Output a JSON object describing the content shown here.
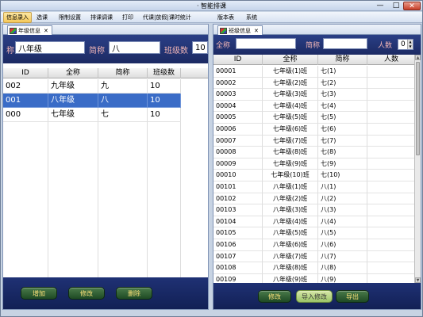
{
  "app": {
    "title": "· 智能排课",
    "minimize": "—",
    "maximize": "□",
    "close": "✕"
  },
  "menu": [
    "信息录入",
    "选课",
    "限制设置",
    "排课调课",
    "打印",
    "代课|放假|课时统计",
    "版本表",
    "系统"
  ],
  "left": {
    "tab_label": "年级信息",
    "tab_close": "✕",
    "form": {
      "name_label": "称",
      "name_value": "八年级",
      "short_label": "简称",
      "short_value": "八",
      "count_label": "班级数",
      "count_value": "10"
    },
    "columns": [
      "ID",
      "全称",
      "简称",
      "班级数"
    ],
    "rows": [
      {
        "id": "002",
        "name": "九年级",
        "short": "九",
        "count": "10",
        "selected": false
      },
      {
        "id": "001",
        "name": "八年级",
        "short": "八",
        "count": "10",
        "selected": true
      },
      {
        "id": "000",
        "name": "七年级",
        "short": "七",
        "count": "10",
        "selected": false
      }
    ],
    "buttons": [
      "增加",
      "修改",
      "删除"
    ]
  },
  "right": {
    "tab_label": "班级信息",
    "tab_close": "✕",
    "form": {
      "name_label": "全称",
      "name_value": "",
      "short_label": "简称",
      "short_value": "",
      "count_label": "人数",
      "count_value": "0"
    },
    "columns": [
      "ID",
      "全称",
      "简称",
      "人数"
    ],
    "rows": [
      {
        "id": "00001",
        "name": "七年级(1)班",
        "short": "七(1)"
      },
      {
        "id": "00002",
        "name": "七年级(2)班",
        "short": "七(2)"
      },
      {
        "id": "00003",
        "name": "七年级(3)班",
        "short": "七(3)"
      },
      {
        "id": "00004",
        "name": "七年级(4)班",
        "short": "七(4)"
      },
      {
        "id": "00005",
        "name": "七年级(5)班",
        "short": "七(5)"
      },
      {
        "id": "00006",
        "name": "七年级(6)班",
        "short": "七(6)"
      },
      {
        "id": "00007",
        "name": "七年级(7)班",
        "short": "七(7)"
      },
      {
        "id": "00008",
        "name": "七年级(8)班",
        "short": "七(8)"
      },
      {
        "id": "00009",
        "name": "七年级(9)班",
        "short": "七(9)"
      },
      {
        "id": "00010",
        "name": "七年级(10)班",
        "short": "七(10)"
      },
      {
        "id": "00101",
        "name": "八年级(1)班",
        "short": "八(1)"
      },
      {
        "id": "00102",
        "name": "八年级(2)班",
        "short": "八(2)"
      },
      {
        "id": "00103",
        "name": "八年级(3)班",
        "short": "八(3)"
      },
      {
        "id": "00104",
        "name": "八年级(4)班",
        "short": "八(4)"
      },
      {
        "id": "00105",
        "name": "八年级(5)班",
        "short": "八(5)"
      },
      {
        "id": "00106",
        "name": "八年级(6)班",
        "short": "八(6)"
      },
      {
        "id": "00107",
        "name": "八年级(7)班",
        "short": "八(7)"
      },
      {
        "id": "00108",
        "name": "八年级(8)班",
        "short": "八(8)"
      },
      {
        "id": "00109",
        "name": "八年级(9)班",
        "short": "八(9)"
      }
    ],
    "buttons": [
      "修改",
      "导入修改",
      "导出"
    ]
  },
  "colors": {
    "header_bg": "#1c2a63",
    "selected_row": "#3a6cc7",
    "button_text": "#ffe37a"
  }
}
